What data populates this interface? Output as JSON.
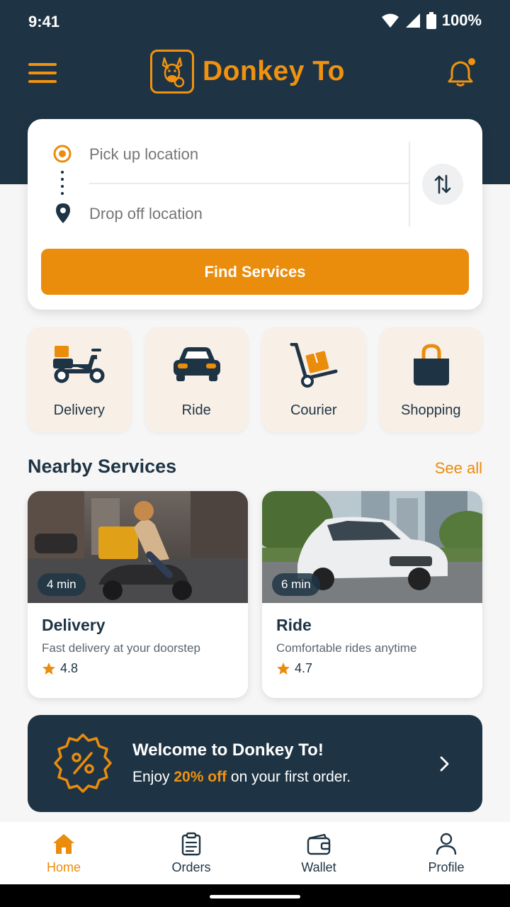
{
  "status_bar": {
    "time": "9:41",
    "battery": "100%"
  },
  "header": {
    "app_name": "Donkey To"
  },
  "search": {
    "pickup_placeholder": "Pick up location",
    "dropoff_placeholder": "Drop off location",
    "find_button": "Find Services"
  },
  "categories": [
    {
      "label": "Delivery",
      "icon": "scooter-icon"
    },
    {
      "label": "Ride",
      "icon": "car-icon"
    },
    {
      "label": "Courier",
      "icon": "hand-truck-icon"
    },
    {
      "label": "Shopping",
      "icon": "shopping-bag-icon"
    }
  ],
  "nearby": {
    "title": "Nearby Services",
    "see_all": "See all",
    "cards": [
      {
        "eta": "4 min",
        "title": "Delivery",
        "description": "Fast delivery at your doorstep",
        "rating": "4.8"
      },
      {
        "eta": "6 min",
        "title": "Ride",
        "description": "Comfortable rides anytime",
        "rating": "4.7"
      }
    ]
  },
  "promo": {
    "title": "Welcome to Donkey To!",
    "sub_before": "Enjoy ",
    "sub_highlight": "20% off",
    "sub_after": " on your first order."
  },
  "nav": [
    {
      "label": "Home",
      "icon": "home-icon",
      "active": true
    },
    {
      "label": "Orders",
      "icon": "clipboard-icon",
      "active": false
    },
    {
      "label": "Wallet",
      "icon": "wallet-icon",
      "active": false
    },
    {
      "label": "Profile",
      "icon": "profile-icon",
      "active": false
    }
  ],
  "colors": {
    "primary": "#ea8c0c",
    "navy": "#1e3444",
    "category_bg": "#f8efe6"
  }
}
